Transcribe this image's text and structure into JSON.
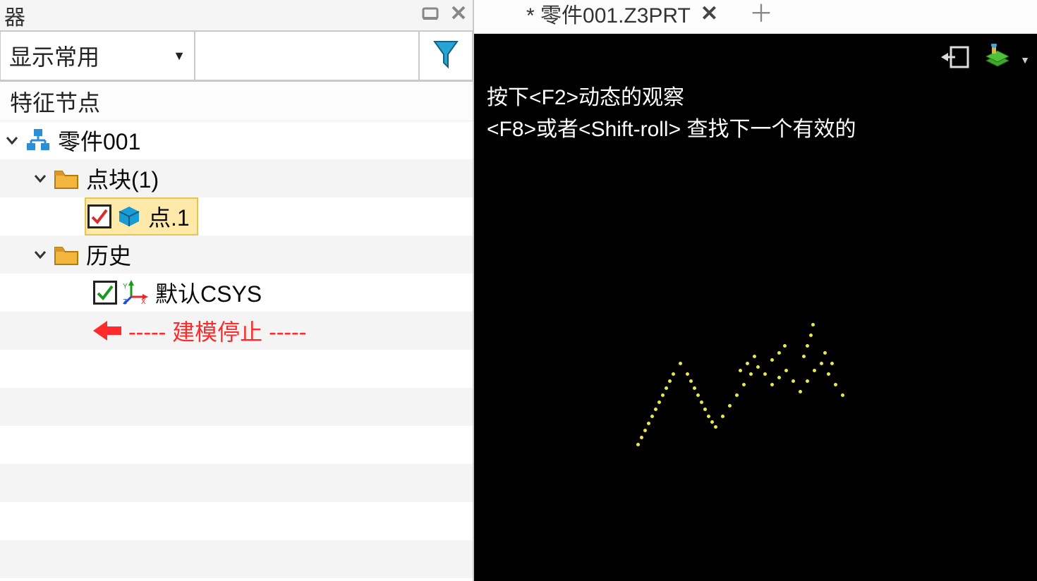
{
  "panel": {
    "title_fragment": "器",
    "dropdown_label": "显示常用",
    "section_header": "特征节点"
  },
  "tree": {
    "root": "零件001",
    "group1": "点块(1)",
    "item1": "点.1",
    "group2": "历史",
    "item2": "默认CSYS",
    "stop_text": "----- 建模停止 -----"
  },
  "tab": {
    "label": "* 零件001.Z3PRT"
  },
  "hints": {
    "line1": "按下<F2>动态的观察",
    "line2": "<F8>或者<Shift-roll> 查找下一个有效的"
  },
  "icons": {
    "minimize": "minimize-icon",
    "close": "close-icon",
    "funnel": "funnel-icon",
    "hierarchy": "hierarchy-icon",
    "folder": "folder-icon",
    "cube": "cube-icon",
    "csys": "csys-icon",
    "arrow_left": "arrow-left-icon",
    "exit": "exit-icon",
    "stack": "stack-icon",
    "plus": "plus-icon",
    "caret_down": "caret-down-icon",
    "chevron_down": "chevron-down-icon"
  }
}
